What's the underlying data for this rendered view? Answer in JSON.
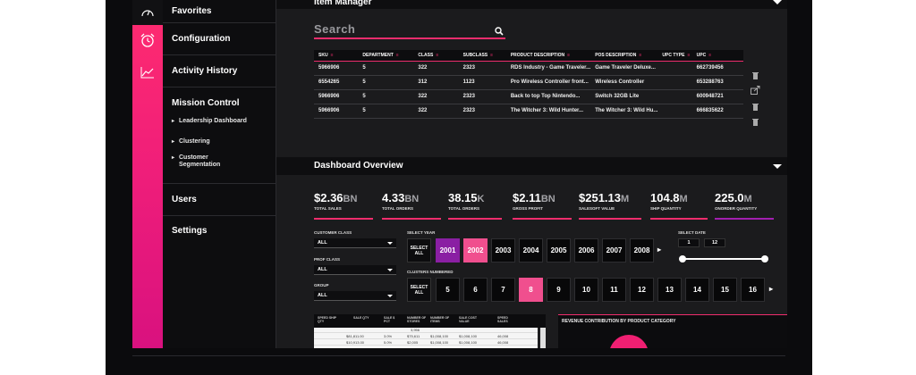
{
  "sidebar": {
    "items": [
      {
        "label": "Favorites"
      },
      {
        "label": "Configuration"
      },
      {
        "label": "Activity History"
      },
      {
        "label": "Mission Control"
      },
      {
        "label": "Users"
      },
      {
        "label": "Settings"
      }
    ],
    "mission_sub": [
      "Leadership Dashboard",
      "Clustering",
      "Customer Segmentation"
    ]
  },
  "item_manager": {
    "title": "Item Manager",
    "search_placeholder": "Search",
    "columns": [
      "SKU",
      "DEPARTMENT",
      "CLASS",
      "SUBCLASS",
      "PRODUCT DESCRIPTION",
      "POS DESCRIPTION",
      "UPC TYPE",
      "UPC"
    ],
    "rows": [
      [
        "5966906",
        "5",
        "322",
        "2323",
        "RDS Industry - Game Traveler...",
        "Game Traveler Deluxe...",
        "",
        "662739456"
      ],
      [
        "6554265",
        "5",
        "312",
        "1123",
        "Pro Wireless Controller front...",
        "Wireless Controller",
        "",
        "653288763"
      ],
      [
        "5966906",
        "5",
        "322",
        "2323",
        "Back to top Top Nintendo...",
        "Switch 32GB Lite",
        "",
        "600948721"
      ],
      [
        "5966906",
        "5",
        "322",
        "2323",
        "The Witcher 3: Wild Hunter...",
        "The Witcher 3: Wild Hu...",
        "",
        "666835622"
      ]
    ]
  },
  "dashboard": {
    "title": "Dashboard Overview",
    "kpis": [
      {
        "value": "$2.36",
        "unit": "BN",
        "label": "TOTAL SALES"
      },
      {
        "value": "4.33",
        "unit": "BN",
        "label": "TOTAL ORDERS"
      },
      {
        "value": "38.15",
        "unit": "K",
        "label": "TOTAL ORDERS"
      },
      {
        "value": "$2.11",
        "unit": "BN",
        "label": "GROSS PROFIT"
      },
      {
        "value": "$251.13",
        "unit": "M",
        "label": "SALESOFT VALUE"
      },
      {
        "value": "104.8",
        "unit": "M",
        "label": "SHIP QUANTITY"
      },
      {
        "value": "225.0",
        "unit": "M",
        "label": "ONORDER QUANTITY"
      }
    ],
    "filters": [
      {
        "label": "CUSTOMER CLASS",
        "value": "ALL"
      },
      {
        "label": "PROF CLASS",
        "value": "ALL"
      },
      {
        "label": "GROUP",
        "value": "ALL"
      }
    ],
    "select_year_label": "SELECT YEAR",
    "select_all_label": "SELECT ALL",
    "years": [
      "2001",
      "2002",
      "2003",
      "2004",
      "2005",
      "2006",
      "2007",
      "2008"
    ],
    "clusters_label": "CLUSTERS NUMBERED",
    "clusters": [
      "5",
      "6",
      "7",
      "8",
      "9",
      "10",
      "11",
      "12",
      "13",
      "14",
      "15",
      "16"
    ],
    "select_date_label": "SELECT DATE",
    "date_boxes": [
      "1",
      "12"
    ],
    "mini_table": {
      "headers": [
        "SPEED SHIP QTY",
        "SALE QTY",
        "SALE $ PCT",
        "NUMBER OF STORES",
        "NUMBER OF ITEMS",
        "SALE COST VALUE",
        "SPEED SALES"
      ],
      "rows": [
        [
          "",
          "",
          "",
          "3,956",
          "",
          "",
          ""
        ],
        [
          "",
          "$81,811.00",
          "3.0%",
          "$75,611",
          "$1,008,100",
          "$1,008,100",
          "46,008"
        ],
        [
          "",
          "$10,913.00",
          "5.0%",
          "$2,005",
          "$1,008,100",
          "$1,008,100",
          "46,008"
        ]
      ]
    },
    "revenue_title": "REVENUE CONTRIBUTION BY PRODUCT CATEGORY"
  },
  "colors": {
    "accent": "#ef2d6d",
    "purple": "#8a1fa3"
  }
}
